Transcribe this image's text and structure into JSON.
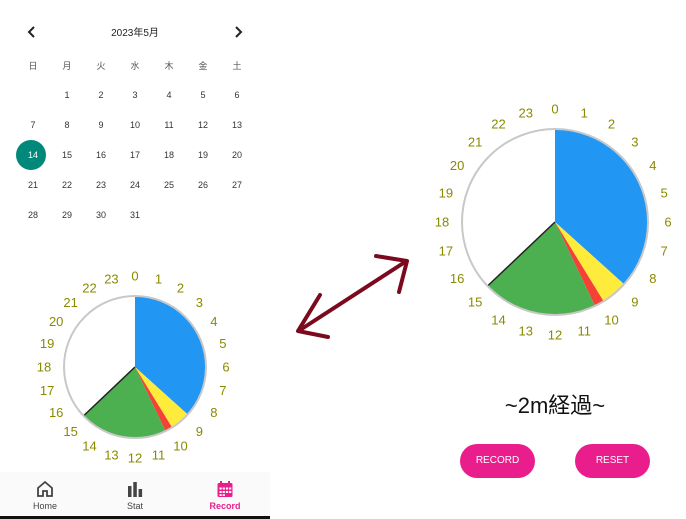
{
  "calendar": {
    "title": "2023年5月",
    "prev_icon": "chevron-left-icon",
    "next_icon": "chevron-right-icon",
    "weekdays": [
      "日",
      "月",
      "火",
      "水",
      "木",
      "金",
      "土"
    ],
    "days": [
      "",
      "1",
      "2",
      "3",
      "4",
      "5",
      "6",
      "7",
      "8",
      "9",
      "10",
      "11",
      "12",
      "13",
      "14",
      "15",
      "16",
      "17",
      "18",
      "19",
      "20",
      "21",
      "22",
      "23",
      "24",
      "25",
      "26",
      "27",
      "28",
      "29",
      "30",
      "31"
    ],
    "selected_day": "14",
    "selected_color": "#00897b"
  },
  "clock": {
    "hour_labels": [
      "0",
      "1",
      "2",
      "3",
      "4",
      "5",
      "6",
      "7",
      "8",
      "9",
      "10",
      "11",
      "12",
      "13",
      "14",
      "15",
      "16",
      "17",
      "18",
      "19",
      "20",
      "21",
      "22",
      "23"
    ],
    "label_color": "#8a8a00",
    "segments": [
      {
        "start_hour": 0,
        "end_hour": 8.8,
        "color": "#2196f3"
      },
      {
        "start_hour": 8.8,
        "end_hour": 9.9,
        "color": "#ffeb3b"
      },
      {
        "start_hour": 9.9,
        "end_hour": 10.3,
        "color": "#f44336"
      },
      {
        "start_hour": 10.3,
        "end_hour": 15.1,
        "color": "#4caf50"
      }
    ]
  },
  "elapsed_text": "~2m経過~",
  "buttons": {
    "record": "RECORD",
    "reset": "RESET"
  },
  "accent_color": "#e91e8c",
  "arrow_color": "#7b0a1e",
  "bottom_nav": {
    "items": [
      {
        "label": "Home",
        "icon": "home-icon"
      },
      {
        "label": "Stat",
        "icon": "bar-chart-icon"
      },
      {
        "label": "Record",
        "icon": "calendar-icon",
        "active": true
      }
    ]
  }
}
